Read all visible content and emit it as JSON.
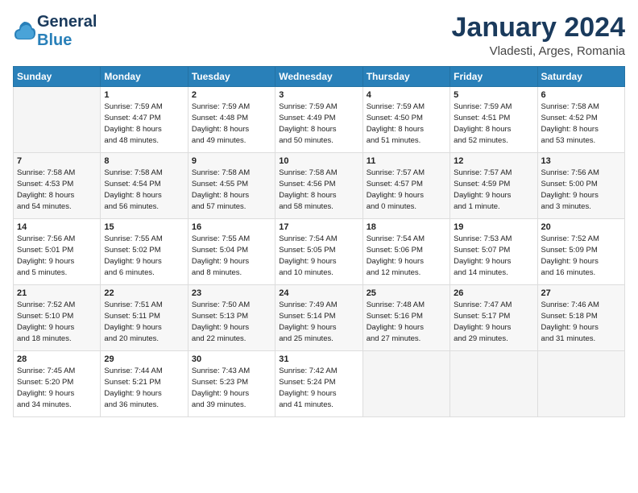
{
  "header": {
    "logo_line1": "General",
    "logo_line2": "Blue",
    "month_title": "January 2024",
    "location": "Vladesti, Arges, Romania"
  },
  "weekdays": [
    "Sunday",
    "Monday",
    "Tuesday",
    "Wednesday",
    "Thursday",
    "Friday",
    "Saturday"
  ],
  "weeks": [
    [
      {
        "num": "",
        "info": ""
      },
      {
        "num": "1",
        "info": "Sunrise: 7:59 AM\nSunset: 4:47 PM\nDaylight: 8 hours\nand 48 minutes."
      },
      {
        "num": "2",
        "info": "Sunrise: 7:59 AM\nSunset: 4:48 PM\nDaylight: 8 hours\nand 49 minutes."
      },
      {
        "num": "3",
        "info": "Sunrise: 7:59 AM\nSunset: 4:49 PM\nDaylight: 8 hours\nand 50 minutes."
      },
      {
        "num": "4",
        "info": "Sunrise: 7:59 AM\nSunset: 4:50 PM\nDaylight: 8 hours\nand 51 minutes."
      },
      {
        "num": "5",
        "info": "Sunrise: 7:59 AM\nSunset: 4:51 PM\nDaylight: 8 hours\nand 52 minutes."
      },
      {
        "num": "6",
        "info": "Sunrise: 7:58 AM\nSunset: 4:52 PM\nDaylight: 8 hours\nand 53 minutes."
      }
    ],
    [
      {
        "num": "7",
        "info": "Sunrise: 7:58 AM\nSunset: 4:53 PM\nDaylight: 8 hours\nand 54 minutes."
      },
      {
        "num": "8",
        "info": "Sunrise: 7:58 AM\nSunset: 4:54 PM\nDaylight: 8 hours\nand 56 minutes."
      },
      {
        "num": "9",
        "info": "Sunrise: 7:58 AM\nSunset: 4:55 PM\nDaylight: 8 hours\nand 57 minutes."
      },
      {
        "num": "10",
        "info": "Sunrise: 7:58 AM\nSunset: 4:56 PM\nDaylight: 8 hours\nand 58 minutes."
      },
      {
        "num": "11",
        "info": "Sunrise: 7:57 AM\nSunset: 4:57 PM\nDaylight: 9 hours\nand 0 minutes."
      },
      {
        "num": "12",
        "info": "Sunrise: 7:57 AM\nSunset: 4:59 PM\nDaylight: 9 hours\nand 1 minute."
      },
      {
        "num": "13",
        "info": "Sunrise: 7:56 AM\nSunset: 5:00 PM\nDaylight: 9 hours\nand 3 minutes."
      }
    ],
    [
      {
        "num": "14",
        "info": "Sunrise: 7:56 AM\nSunset: 5:01 PM\nDaylight: 9 hours\nand 5 minutes."
      },
      {
        "num": "15",
        "info": "Sunrise: 7:55 AM\nSunset: 5:02 PM\nDaylight: 9 hours\nand 6 minutes."
      },
      {
        "num": "16",
        "info": "Sunrise: 7:55 AM\nSunset: 5:04 PM\nDaylight: 9 hours\nand 8 minutes."
      },
      {
        "num": "17",
        "info": "Sunrise: 7:54 AM\nSunset: 5:05 PM\nDaylight: 9 hours\nand 10 minutes."
      },
      {
        "num": "18",
        "info": "Sunrise: 7:54 AM\nSunset: 5:06 PM\nDaylight: 9 hours\nand 12 minutes."
      },
      {
        "num": "19",
        "info": "Sunrise: 7:53 AM\nSunset: 5:07 PM\nDaylight: 9 hours\nand 14 minutes."
      },
      {
        "num": "20",
        "info": "Sunrise: 7:52 AM\nSunset: 5:09 PM\nDaylight: 9 hours\nand 16 minutes."
      }
    ],
    [
      {
        "num": "21",
        "info": "Sunrise: 7:52 AM\nSunset: 5:10 PM\nDaylight: 9 hours\nand 18 minutes."
      },
      {
        "num": "22",
        "info": "Sunrise: 7:51 AM\nSunset: 5:11 PM\nDaylight: 9 hours\nand 20 minutes."
      },
      {
        "num": "23",
        "info": "Sunrise: 7:50 AM\nSunset: 5:13 PM\nDaylight: 9 hours\nand 22 minutes."
      },
      {
        "num": "24",
        "info": "Sunrise: 7:49 AM\nSunset: 5:14 PM\nDaylight: 9 hours\nand 25 minutes."
      },
      {
        "num": "25",
        "info": "Sunrise: 7:48 AM\nSunset: 5:16 PM\nDaylight: 9 hours\nand 27 minutes."
      },
      {
        "num": "26",
        "info": "Sunrise: 7:47 AM\nSunset: 5:17 PM\nDaylight: 9 hours\nand 29 minutes."
      },
      {
        "num": "27",
        "info": "Sunrise: 7:46 AM\nSunset: 5:18 PM\nDaylight: 9 hours\nand 31 minutes."
      }
    ],
    [
      {
        "num": "28",
        "info": "Sunrise: 7:45 AM\nSunset: 5:20 PM\nDaylight: 9 hours\nand 34 minutes."
      },
      {
        "num": "29",
        "info": "Sunrise: 7:44 AM\nSunset: 5:21 PM\nDaylight: 9 hours\nand 36 minutes."
      },
      {
        "num": "30",
        "info": "Sunrise: 7:43 AM\nSunset: 5:23 PM\nDaylight: 9 hours\nand 39 minutes."
      },
      {
        "num": "31",
        "info": "Sunrise: 7:42 AM\nSunset: 5:24 PM\nDaylight: 9 hours\nand 41 minutes."
      },
      {
        "num": "",
        "info": ""
      },
      {
        "num": "",
        "info": ""
      },
      {
        "num": "",
        "info": ""
      }
    ]
  ]
}
